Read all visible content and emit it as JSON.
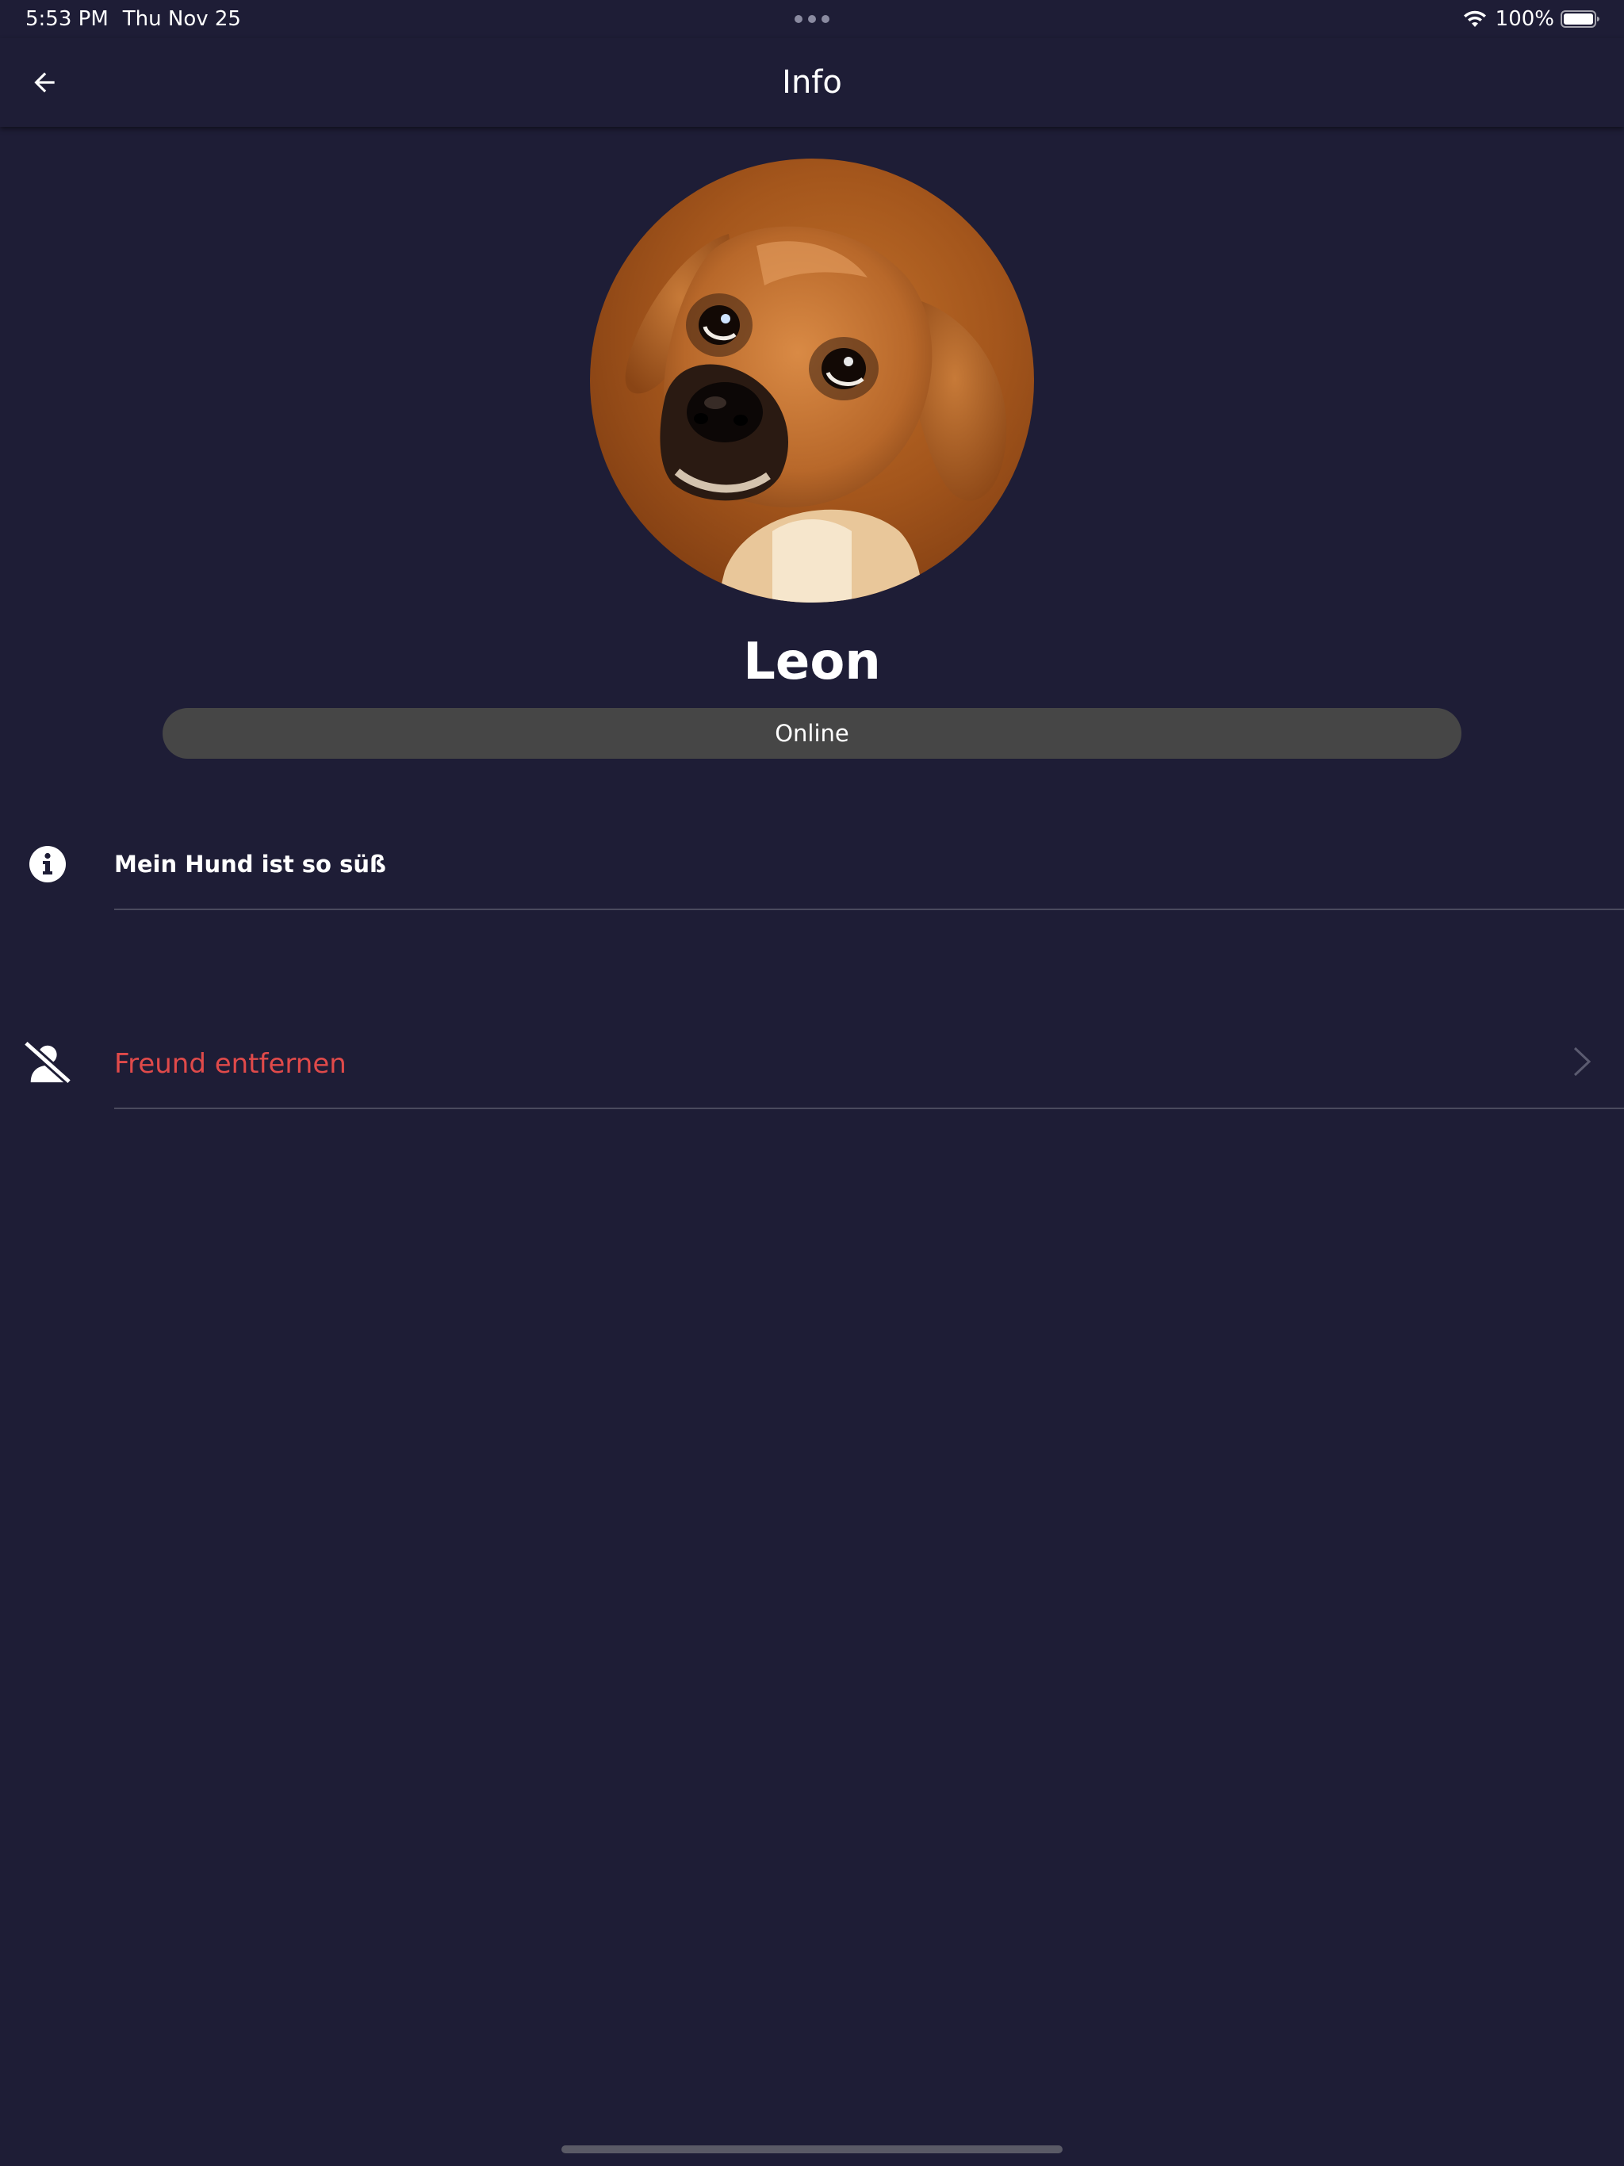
{
  "status_bar": {
    "time": "5:53 PM",
    "date": "Thu Nov 25",
    "battery": "100%"
  },
  "app_bar": {
    "title": "Info",
    "back_icon": "arrow-left-icon"
  },
  "profile": {
    "avatar": "dog-photo",
    "name": "Leon",
    "status": "Online"
  },
  "about": {
    "icon": "info-circle-icon",
    "text": "Mein Hund ist so süß"
  },
  "actions": {
    "remove_friend": {
      "icon": "person-off-icon",
      "label": "Freund entfernen",
      "trailing_icon": "chevron-right-icon"
    }
  },
  "colors": {
    "background": "#1e1d36",
    "pill": "#464646",
    "danger": "#e04a4a",
    "text": "#ffffff"
  }
}
